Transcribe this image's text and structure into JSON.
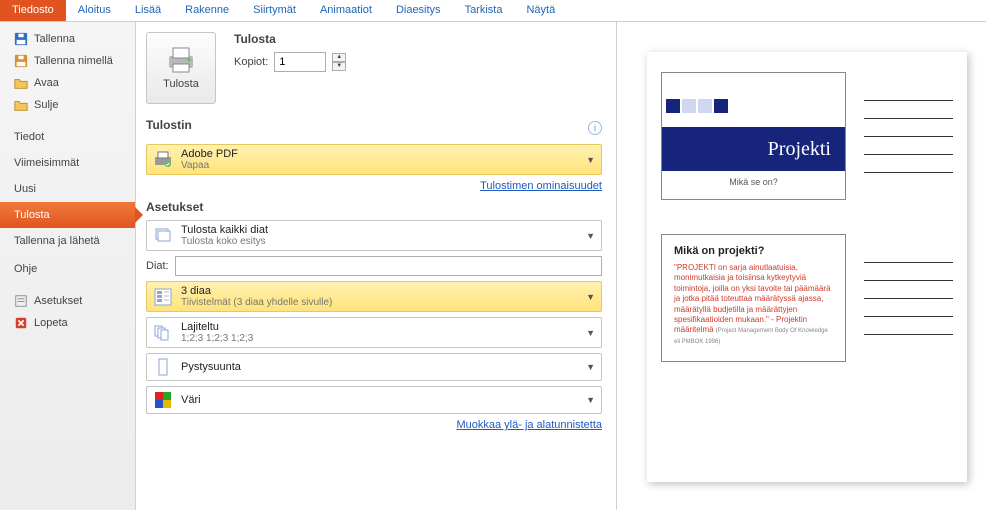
{
  "ribbon": {
    "tabs": [
      "Tiedosto",
      "Aloitus",
      "Lisää",
      "Rakenne",
      "Siirtymät",
      "Animaatiot",
      "Diaesitys",
      "Tarkista",
      "Näytä"
    ],
    "active": 0
  },
  "leftnav": {
    "top": [
      {
        "label": "Tallenna",
        "icon": "save"
      },
      {
        "label": "Tallenna nimellä",
        "icon": "save-as"
      },
      {
        "label": "Avaa",
        "icon": "open"
      },
      {
        "label": "Sulje",
        "icon": "close-doc"
      }
    ],
    "mid": [
      {
        "label": "Tiedot"
      },
      {
        "label": "Viimeisimmät"
      },
      {
        "label": "Uusi"
      },
      {
        "label": "Tulosta",
        "selected": true
      },
      {
        "label": "Tallenna ja lähetä"
      },
      {
        "label": "Ohje"
      }
    ],
    "bottom": [
      {
        "label": "Asetukset",
        "icon": "options"
      },
      {
        "label": "Lopeta",
        "icon": "exit"
      }
    ]
  },
  "print": {
    "heading": "Tulosta",
    "button": "Tulosta",
    "copies_label": "Kopiot:",
    "copies_value": "1"
  },
  "printer": {
    "heading": "Tulostin",
    "name": "Adobe PDF",
    "status": "Vapaa",
    "props_link": "Tulostimen ominaisuudet"
  },
  "settings": {
    "heading": "Asetukset",
    "what_title": "Tulosta kaikki diat",
    "what_sub": "Tulosta koko esitys",
    "slides_label": "Diat:",
    "slides_value": "",
    "layout_title": "3 diaa",
    "layout_sub": "Tiivistelmät (3 diaa yhdelle sivulle)",
    "collate_title": "Lajiteltu",
    "collate_sub": "1;2;3   1;2;3   1;2;3",
    "orient_title": "Pystysuunta",
    "color_title": "Väri",
    "edit_link": "Muokkaa ylä- ja alatunnistetta"
  },
  "preview": {
    "slide1": {
      "title": "Projekti",
      "sub": "Mikä se on?"
    },
    "slide2": {
      "title": "Mikä on projekti?",
      "body": "\"PROJEKTI on sarja ainutlaatuisia, monimutkaisia ja toisiinsa kytkeytyviä toimintoja, joilla on yksi tavoite tai päämäärä ja jotka pitää toteuttaa määrätyssä ajassa, määrätyllä budjetilla ja määrättyjen spesifikaatioiden mukaan.\" - Projektin määritelmä ",
      "cite": "(Project Management Body Of Knowledge eli PMBOK 1996)"
    }
  }
}
